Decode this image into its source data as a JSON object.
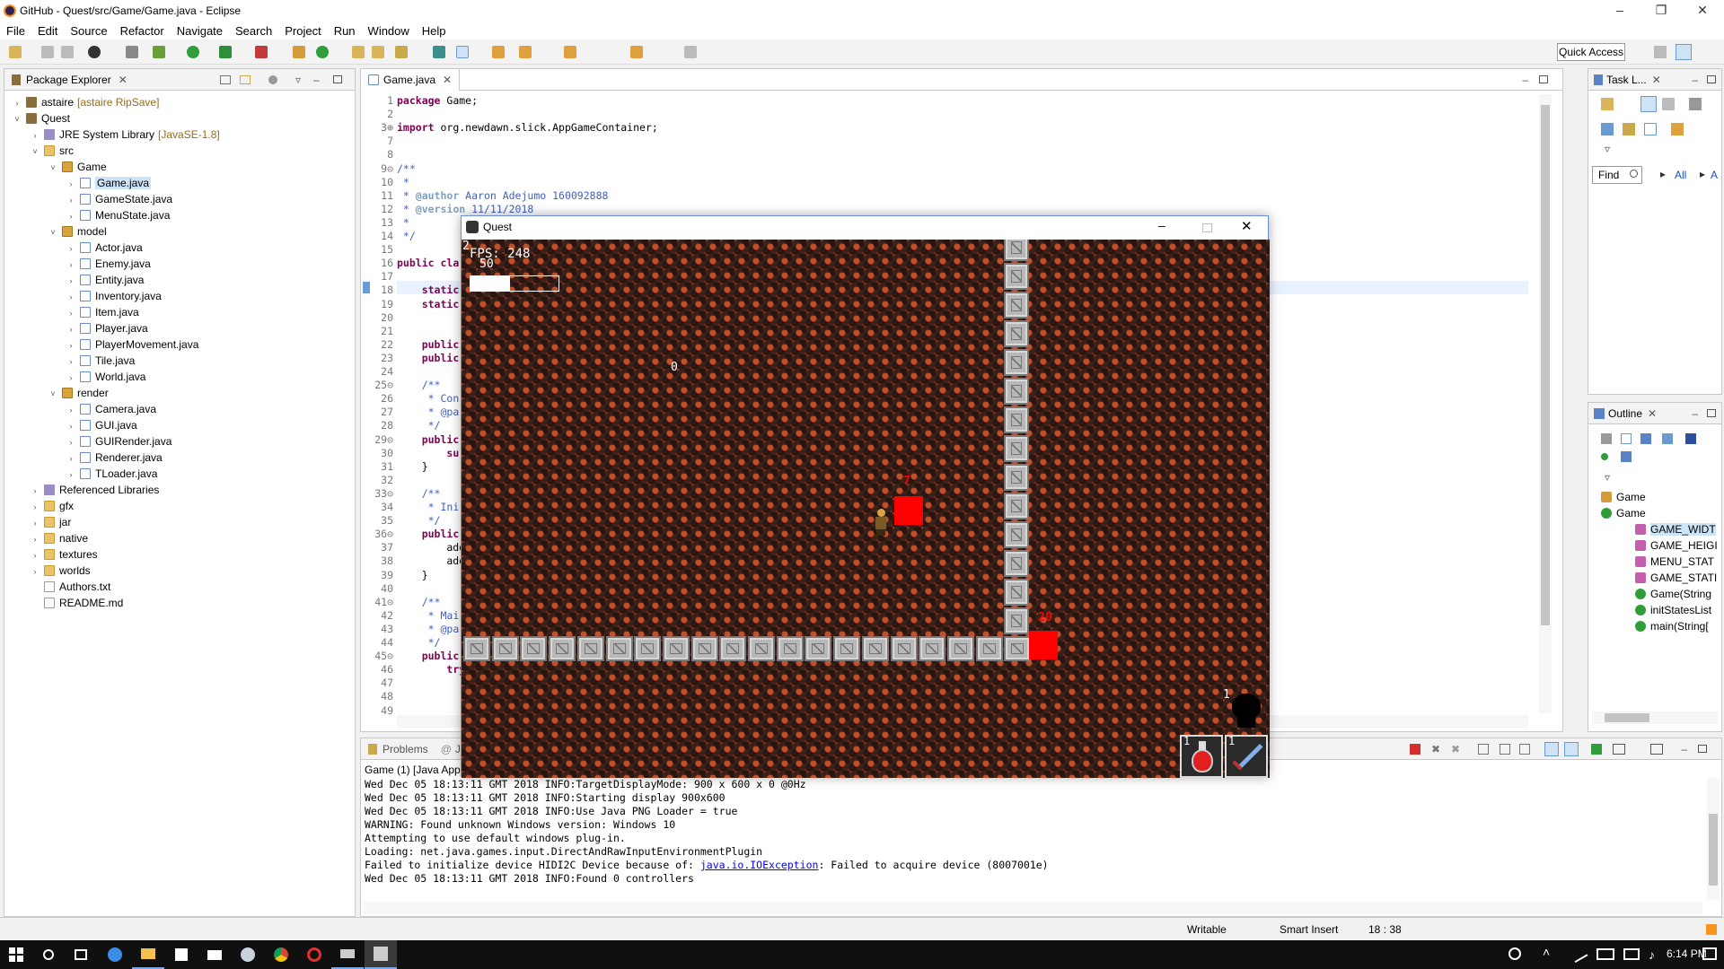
{
  "window": {
    "title": "GitHub - Quest/src/Game/Game.java - Eclipse"
  },
  "menu": [
    "File",
    "Edit",
    "Source",
    "Refactor",
    "Navigate",
    "Search",
    "Project",
    "Run",
    "Window",
    "Help"
  ],
  "quick_access": "Quick Access",
  "package_explorer": {
    "tab": "Package Explorer",
    "rows": [
      {
        "label": "astaire",
        "decoration": "[astaire RipSave]",
        "icon": "project-icon",
        "depth": 0,
        "chev": "›"
      },
      {
        "label": "Quest",
        "icon": "project-icon",
        "depth": 0,
        "chev": "˅"
      },
      {
        "label": "JRE System Library",
        "decoration": "[JavaSE-1.8]",
        "icon": "library-icon",
        "depth": 1,
        "chev": "›"
      },
      {
        "label": "src",
        "icon": "folder-icon",
        "depth": 1,
        "chev": "˅"
      },
      {
        "label": "Game",
        "icon": "package-icon",
        "depth": 2,
        "chev": "˅"
      },
      {
        "label": "Game.java",
        "icon": "java-file-icon",
        "depth": 3,
        "chev": "›",
        "selected": true
      },
      {
        "label": "GameState.java",
        "icon": "java-file-icon",
        "depth": 3,
        "chev": "›"
      },
      {
        "label": "MenuState.java",
        "icon": "java-file-icon",
        "depth": 3,
        "chev": "›"
      },
      {
        "label": "model",
        "icon": "package-icon",
        "depth": 2,
        "chev": "˅"
      },
      {
        "label": "Actor.java",
        "icon": "java-file-icon",
        "depth": 3,
        "chev": "›"
      },
      {
        "label": "Enemy.java",
        "icon": "java-file-icon",
        "depth": 3,
        "chev": "›"
      },
      {
        "label": "Entity.java",
        "icon": "java-file-icon",
        "depth": 3,
        "chev": "›"
      },
      {
        "label": "Inventory.java",
        "icon": "java-file-icon",
        "depth": 3,
        "chev": "›"
      },
      {
        "label": "Item.java",
        "icon": "java-file-icon",
        "depth": 3,
        "chev": "›"
      },
      {
        "label": "Player.java",
        "icon": "java-file-icon",
        "depth": 3,
        "chev": "›"
      },
      {
        "label": "PlayerMovement.java",
        "icon": "java-file-icon",
        "depth": 3,
        "chev": "›"
      },
      {
        "label": "Tile.java",
        "icon": "java-file-icon",
        "depth": 3,
        "chev": "›"
      },
      {
        "label": "World.java",
        "icon": "java-file-icon",
        "depth": 3,
        "chev": "›"
      },
      {
        "label": "render",
        "icon": "package-icon",
        "depth": 2,
        "chev": "˅"
      },
      {
        "label": "Camera.java",
        "icon": "java-file-icon",
        "depth": 3,
        "chev": "›"
      },
      {
        "label": "GUI.java",
        "icon": "java-file-icon",
        "depth": 3,
        "chev": "›"
      },
      {
        "label": "GUIRender.java",
        "icon": "java-file-icon",
        "depth": 3,
        "chev": "›"
      },
      {
        "label": "Renderer.java",
        "icon": "java-file-icon",
        "depth": 3,
        "chev": "›"
      },
      {
        "label": "TLoader.java",
        "icon": "java-file-icon",
        "depth": 3,
        "chev": "›"
      },
      {
        "label": "Referenced Libraries",
        "icon": "library-icon",
        "depth": 1,
        "chev": "›"
      },
      {
        "label": "gfx",
        "icon": "folder-icon",
        "depth": 1,
        "chev": "›"
      },
      {
        "label": "jar",
        "icon": "folder-icon",
        "depth": 1,
        "chev": "›"
      },
      {
        "label": "native",
        "icon": "folder-icon",
        "depth": 1,
        "chev": "›"
      },
      {
        "label": "textures",
        "icon": "folder-icon",
        "depth": 1,
        "chev": "›"
      },
      {
        "label": "worlds",
        "icon": "folder-icon",
        "depth": 1,
        "chev": "›"
      },
      {
        "label": "Authors.txt",
        "icon": "text-file-icon",
        "depth": 1,
        "chev": ""
      },
      {
        "label": "README.md",
        "icon": "text-file-icon",
        "depth": 1,
        "chev": ""
      }
    ]
  },
  "editor": {
    "tab": "Game.java",
    "lines": [
      {
        "n": "1",
        "html": "<span class='kw'>package</span> Game;"
      },
      {
        "n": "2",
        "html": ""
      },
      {
        "n": "3⊕",
        "html": "<span class='kw'>import</span> org.newdawn.slick.AppGameContainer;"
      },
      {
        "n": "7",
        "html": ""
      },
      {
        "n": "8",
        "html": ""
      },
      {
        "n": "9⊝",
        "html": "<span class='cm'>/**</span>"
      },
      {
        "n": "10",
        "html": "<span class='cm'> *</span>"
      },
      {
        "n": "11",
        "html": "<span class='cm'> * <span class='tg'>@author</span> Aaron Adejumo 160092888</span>"
      },
      {
        "n": "12",
        "html": "<span class='cm'> * <span class='tg'>@version</span> 11/11/2018</span>"
      },
      {
        "n": "13",
        "html": "<span class='cm'> *</span>"
      },
      {
        "n": "14",
        "html": "<span class='cm'> */</span>"
      },
      {
        "n": "15",
        "html": ""
      },
      {
        "n": "16",
        "html": "<span class='kw'>public</span> <span class='kw'>cla</span>"
      },
      {
        "n": "17",
        "html": ""
      },
      {
        "n": "18",
        "html": "    <span class='kw'>static</span>"
      },
      {
        "n": "19",
        "html": "    <span class='kw'>static</span>"
      },
      {
        "n": "20",
        "html": ""
      },
      {
        "n": "21",
        "html": ""
      },
      {
        "n": "22",
        "html": "    <span class='kw'>public</span>"
      },
      {
        "n": "23",
        "html": "    <span class='kw'>public</span>"
      },
      {
        "n": "24",
        "html": ""
      },
      {
        "n": "25⊝",
        "html": "    <span class='cm'>/**</span>"
      },
      {
        "n": "26",
        "html": "    <span class='cm'> * Con</span>"
      },
      {
        "n": "27",
        "html": "    <span class='cm'> * @pa</span>"
      },
      {
        "n": "28",
        "html": "    <span class='cm'> */</span>"
      },
      {
        "n": "29⊝",
        "html": "    <span class='kw'>public</span>"
      },
      {
        "n": "30",
        "html": "        <span class='kw'>su</span>"
      },
      {
        "n": "31",
        "html": "    }"
      },
      {
        "n": "32",
        "html": ""
      },
      {
        "n": "33⊝",
        "html": "    <span class='cm'>/**</span>"
      },
      {
        "n": "34",
        "html": "    <span class='cm'> * Ini</span>"
      },
      {
        "n": "35",
        "html": "    <span class='cm'> */</span>"
      },
      {
        "n": "36⊝",
        "html": "    <span class='kw'>public</span>"
      },
      {
        "n": "37",
        "html": "        add"
      },
      {
        "n": "38",
        "html": "        add"
      },
      {
        "n": "39",
        "html": "    }"
      },
      {
        "n": "40",
        "html": ""
      },
      {
        "n": "41⊝",
        "html": "    <span class='cm'>/**</span>"
      },
      {
        "n": "42",
        "html": "    <span class='cm'> * Mai</span>"
      },
      {
        "n": "43",
        "html": "    <span class='cm'> * @pa</span>"
      },
      {
        "n": "44",
        "html": "    <span class='cm'> */</span>"
      },
      {
        "n": "45⊝",
        "html": "    <span class='kw'>public</span>"
      },
      {
        "n": "46",
        "html": "        <span class='kw'>try</span>"
      },
      {
        "n": "47",
        "html": ""
      },
      {
        "n": "48",
        "html": ""
      },
      {
        "n": "49",
        "html": ""
      }
    ]
  },
  "task_list": {
    "tab": "Task L...",
    "find": "Find",
    "all": "All",
    "activate": "A"
  },
  "outline": {
    "tab": "Outline",
    "items": [
      {
        "label": "Game",
        "icon": "package-icon",
        "indent": 0
      },
      {
        "label": "Game",
        "icon": "class-icon",
        "indent": 0
      },
      {
        "label": "GAME_WIDT",
        "icon": "field-icon",
        "indent": 1,
        "selected": true
      },
      {
        "label": "GAME_HEIGI",
        "icon": "field-icon",
        "indent": 1
      },
      {
        "label": "MENU_STAT",
        "icon": "field-icon",
        "indent": 1
      },
      {
        "label": "GAME_STATI",
        "icon": "field-icon",
        "indent": 1
      },
      {
        "label": "Game(String",
        "icon": "constructor-icon",
        "indent": 1
      },
      {
        "label": "initStatesList",
        "icon": "method-icon",
        "indent": 1
      },
      {
        "label": "main(String[",
        "icon": "method-icon",
        "indent": 1
      }
    ]
  },
  "console": {
    "tabs": [
      "Problems",
      "Ja"
    ],
    "header": "Game (1) [Java Appli",
    "lines": [
      {
        "text": "Wed Dec 05 18:13:11 GMT 2018 INFO:TargetDisplayMode: 900 x 600 x 0 @0Hz"
      },
      {
        "text": "Wed Dec 05 18:13:11 GMT 2018 INFO:Starting display 900x600"
      },
      {
        "text": "Wed Dec 05 18:13:11 GMT 2018 INFO:Use Java PNG Loader = true"
      },
      {
        "text": "WARNING: Found unknown Windows version: Windows 10"
      },
      {
        "text": "Attempting to use default windows plug-in."
      },
      {
        "text": "Loading: net.java.games.input.DirectAndRawInputEnvironmentPlugin"
      },
      {
        "text": "Failed to initialize device HIDI2C Device because of: ",
        "link": "java.io.IOException",
        "after": ": Failed to acquire device (8007001e)"
      },
      {
        "text": "Wed Dec 05 18:13:11 GMT 2018 INFO:Found 0 controllers"
      }
    ]
  },
  "status": {
    "writable": "Writable",
    "insert": "Smart Insert",
    "position": "18 : 38"
  },
  "taskbar": {
    "time": "6:14 PM"
  },
  "game": {
    "title": "Quest",
    "level": "2",
    "fps": "FPS: 248",
    "health": "50",
    "health_fraction": 0.45,
    "zero": "0",
    "enemy1_hp": "7",
    "enemy2_hp": "20",
    "skull_count": "1",
    "potion_count": "1",
    "sword_count": "1"
  }
}
